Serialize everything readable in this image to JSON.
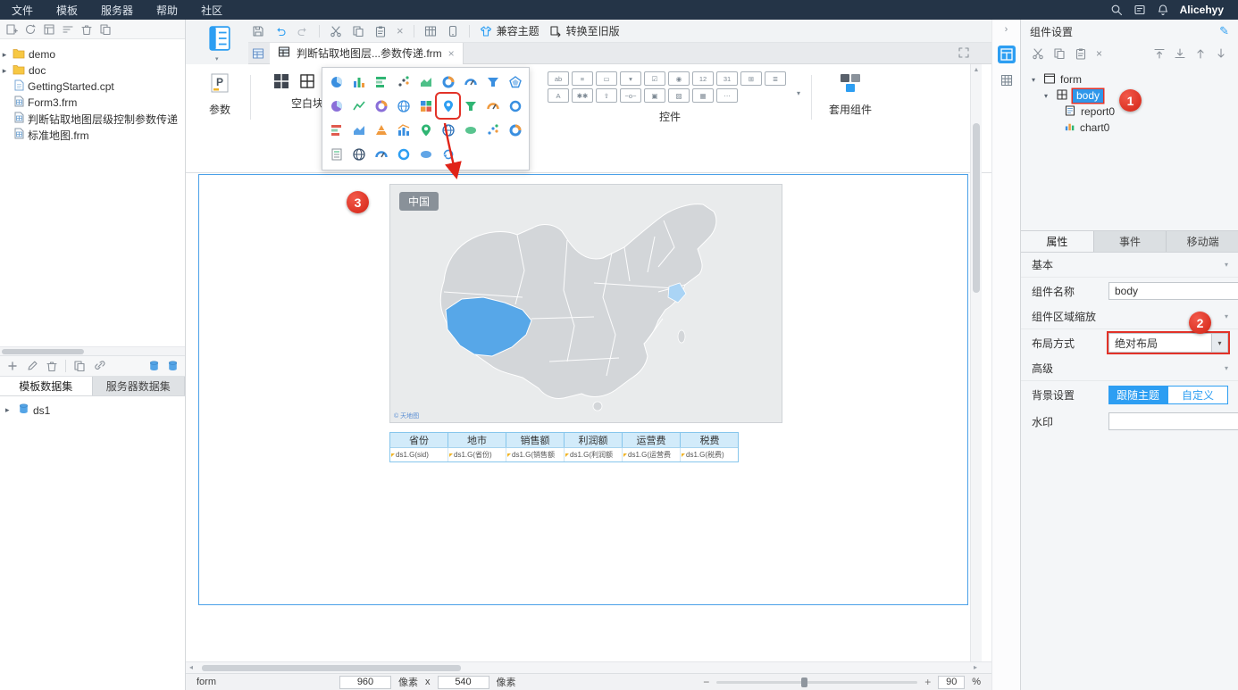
{
  "colors": {
    "accent": "#2d9ef2",
    "annotation": "#e23228",
    "map_highlight": "#57a7e8",
    "map_highlight_light": "#aad4f5"
  },
  "menubar": {
    "items": [
      "文件",
      "模板",
      "服务器",
      "帮助",
      "社区"
    ],
    "username": "Alicehyy"
  },
  "left_panel": {
    "tree": [
      {
        "label": "demo",
        "type": "folder"
      },
      {
        "label": "doc",
        "type": "folder"
      },
      {
        "label": "GettingStarted.cpt",
        "type": "file"
      },
      {
        "label": "Form3.frm",
        "type": "file"
      },
      {
        "label": "判断钻取地图层级控制参数传递",
        "type": "file"
      },
      {
        "label": "标准地图.frm",
        "type": "file"
      }
    ],
    "dataset_tabs": [
      {
        "label": "模板数据集",
        "active": true
      },
      {
        "label": "服务器数据集",
        "active": false
      }
    ],
    "datasets": [
      {
        "label": "ds1"
      }
    ]
  },
  "main_toolbar": {
    "compat_theme": "兼容主题",
    "convert_legacy": "转换至旧版"
  },
  "doc_tab": {
    "title": "判断钻取地图层...参数传递.frm"
  },
  "palette": {
    "param_label": "参数",
    "blank_label": "空白块",
    "controls_label": "控件",
    "reuse_label": "套用组件",
    "chart_icons": [
      {
        "name": "pie-chart",
        "type": "pie",
        "color": "#3a8fe0"
      },
      {
        "name": "column-chart",
        "type": "bar",
        "color": "#3a8fe0"
      },
      {
        "name": "bar-chart",
        "type": "hbar",
        "color": "#2fb573"
      },
      {
        "name": "scatter-chart",
        "type": "scatter",
        "color": "#4a5560"
      },
      {
        "name": "area-chart",
        "type": "area",
        "color": "#2fb573"
      },
      {
        "name": "donut-chart",
        "type": "donut",
        "color": "#3a8fe0"
      },
      {
        "name": "gauge-chart",
        "type": "gauge",
        "color": "#3a8fe0"
      },
      {
        "name": "funnel-chart",
        "type": "funnel",
        "color": "#3a8fe0"
      },
      {
        "name": "radar-chart",
        "type": "radar",
        "color": "#3a8fe0"
      },
      {
        "name": "rose-chart",
        "type": "pie",
        "color": "#8a6fd8"
      },
      {
        "name": "line-chart",
        "type": "line",
        "color": "#2fb573"
      },
      {
        "name": "multi-pie-chart",
        "type": "donut",
        "color": "#8a6fd8"
      },
      {
        "name": "globe-chart",
        "type": "globe",
        "color": "#3a8fe0"
      },
      {
        "name": "heatmap-chart",
        "type": "grid4",
        "color": "#3a8fe0"
      },
      {
        "name": "gis-map-chart",
        "type": "pin",
        "color": "#2d9ef2",
        "box": true
      },
      {
        "name": "funnel3d-chart",
        "type": "funnel",
        "color": "#2fb573"
      },
      {
        "name": "dial-chart",
        "type": "gauge",
        "color": "#f09a3e"
      },
      {
        "name": "spiral-chart",
        "type": "ring",
        "color": "#3a8fe0"
      },
      {
        "name": "stack-bar-chart",
        "type": "hbar",
        "color": "#e05a4e"
      },
      {
        "name": "range-area-chart",
        "type": "area",
        "color": "#3a8fe0"
      },
      {
        "name": "pyramid-chart",
        "type": "pyramid",
        "color": "#f09a3e"
      },
      {
        "name": "combo-chart",
        "type": "combo",
        "color": "#3a8fe0"
      },
      {
        "name": "drill-map-chart",
        "type": "pin",
        "color": "#2fb573"
      },
      {
        "name": "world-map-chart",
        "type": "globe",
        "color": "#2a6fb8"
      },
      {
        "name": "word-cloud-chart",
        "type": "oval",
        "color": "#2fb573"
      },
      {
        "name": "bubble-chart",
        "type": "scatter",
        "color": "#3a8fe0"
      },
      {
        "name": "donut-small-chart",
        "type": "donut",
        "color": "#3a8fe0"
      },
      {
        "name": "report-block-chart",
        "type": "doc",
        "color": "#8a9199"
      },
      {
        "name": "earth-chart",
        "type": "globe",
        "color": "#39506b"
      },
      {
        "name": "meter-chart",
        "type": "gauge",
        "color": "#3a8fe0"
      },
      {
        "name": "ring-chart",
        "type": "ring",
        "color": "#2d9ef2"
      },
      {
        "name": "ellipse-chart",
        "type": "oval",
        "color": "#3a8fe0"
      },
      {
        "name": "cycle-chart",
        "type": "cycle",
        "color": "#3a8fe0"
      }
    ],
    "control_icons": [
      {
        "name": "text-widget",
        "glyph": "ab"
      },
      {
        "name": "textarea-widget",
        "glyph": "≡"
      },
      {
        "name": "button-widget",
        "glyph": "▭"
      },
      {
        "name": "dropdown-widget",
        "glyph": "▾"
      },
      {
        "name": "checkbox-widget",
        "glyph": "☑"
      },
      {
        "name": "radio-widget",
        "glyph": "◉"
      },
      {
        "name": "number-widget",
        "glyph": "12"
      },
      {
        "name": "date-widget",
        "glyph": "31"
      },
      {
        "name": "tree-widget",
        "glyph": "⊞"
      },
      {
        "name": "list-widget",
        "glyph": "≣"
      },
      {
        "name": "label-widget",
        "glyph": "A"
      },
      {
        "name": "password-widget",
        "glyph": "✱✱"
      },
      {
        "name": "upload-widget",
        "glyph": "⇧"
      },
      {
        "name": "slider-widget",
        "glyph": "−o−"
      },
      {
        "name": "iframe-widget",
        "glyph": "▣"
      },
      {
        "name": "image-widget",
        "glyph": "▨"
      },
      {
        "name": "grid-widget",
        "glyph": "▦"
      },
      {
        "name": "more-widget",
        "glyph": "⋯"
      }
    ]
  },
  "canvas": {
    "map": {
      "region_label": "中国",
      "attribution": "© 天地图"
    },
    "table": {
      "headers": [
        "省份",
        "地市",
        "销售额",
        "利润额",
        "运营费",
        "税费"
      ],
      "cells": [
        "ds1.G(sid)",
        "ds1.G(省份)",
        "ds1.G(销售额",
        "ds1.G(利润额",
        "ds1.G(运营费",
        "ds1.G(税费)"
      ]
    }
  },
  "statusbar": {
    "mode": "form",
    "width": "960",
    "height": "540",
    "unit": "像素",
    "times": "x",
    "minus": "−",
    "plus": "+",
    "zoom": "90",
    "percent": "%"
  },
  "right_panel": {
    "title": "组件设置",
    "tree": [
      {
        "label": "form"
      },
      {
        "label": "body"
      },
      {
        "label": "report0"
      },
      {
        "label": "chart0"
      }
    ],
    "tabs": [
      {
        "label": "属性",
        "active": true
      },
      {
        "label": "事件"
      },
      {
        "label": "移动端"
      }
    ],
    "sections": {
      "basic": "基本",
      "advanced": "高级"
    },
    "props": {
      "name_label": "组件名称",
      "name_value": "body",
      "scale_label": "组件区域缩放",
      "layout_label": "布局方式",
      "layout_value": "绝对布局",
      "bg_label": "背景设置",
      "bg_follow": "跟随主题",
      "bg_custom": "自定义",
      "watermark_label": "水印",
      "more": "…"
    }
  },
  "annotations": {
    "step1": "1",
    "step2": "2",
    "step3": "3"
  }
}
